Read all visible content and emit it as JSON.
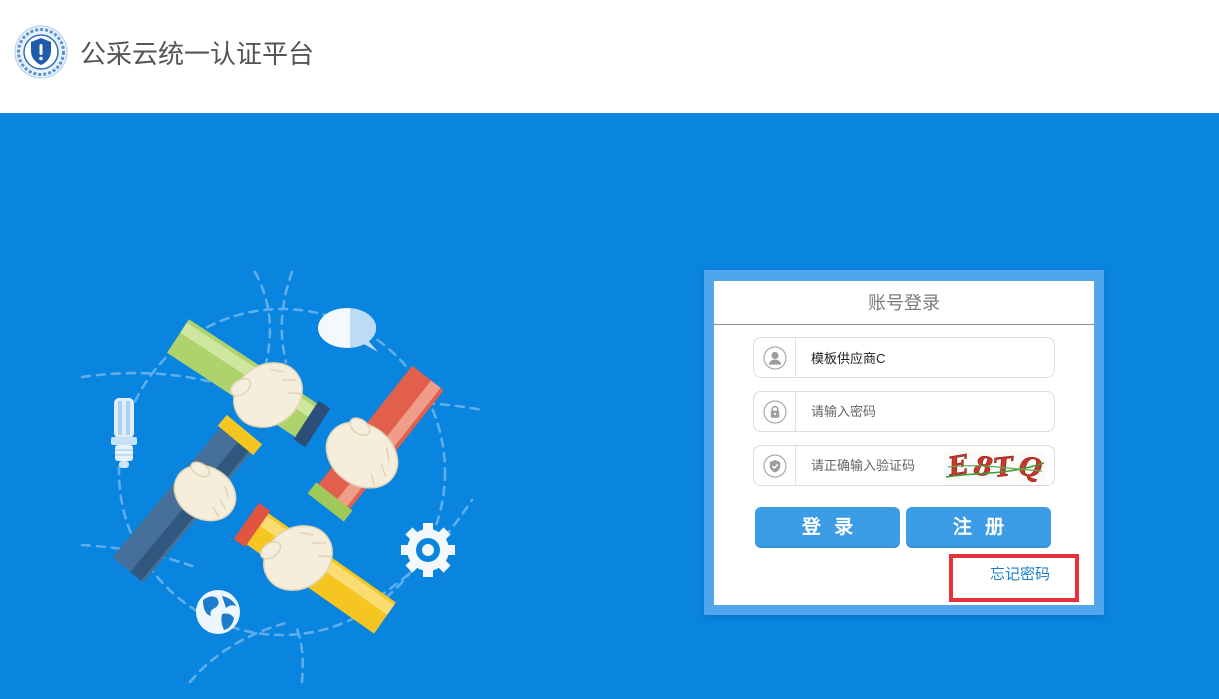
{
  "header": {
    "logo_icon": "shield-emblem-icon",
    "title": "公采云统一认证平台"
  },
  "illustration": {
    "icons": {
      "hands": "handshake-icon",
      "bulb": "lightbulb-icon",
      "chat": "chat-bubble-icon",
      "gear": "gear-icon",
      "globe": "globe-icon"
    }
  },
  "login": {
    "title": "账号登录",
    "username": {
      "icon": "user-icon",
      "value": "模板供应商C"
    },
    "password": {
      "icon": "lock-icon",
      "placeholder": "请输入密码"
    },
    "captcha": {
      "icon": "shield-check-icon",
      "placeholder": "请正确输入验证码",
      "image_text": "E8TQ"
    },
    "login_button": "登 录",
    "register_button": "注 册",
    "forgot_password": "忘记密码"
  },
  "colors": {
    "page_background": "#0984df",
    "header_background": "#ffffff",
    "panel_frame": "#4fa6ec",
    "button": "#3c9de6",
    "link": "#1b7fcb",
    "highlight_box": "#e5323a"
  }
}
